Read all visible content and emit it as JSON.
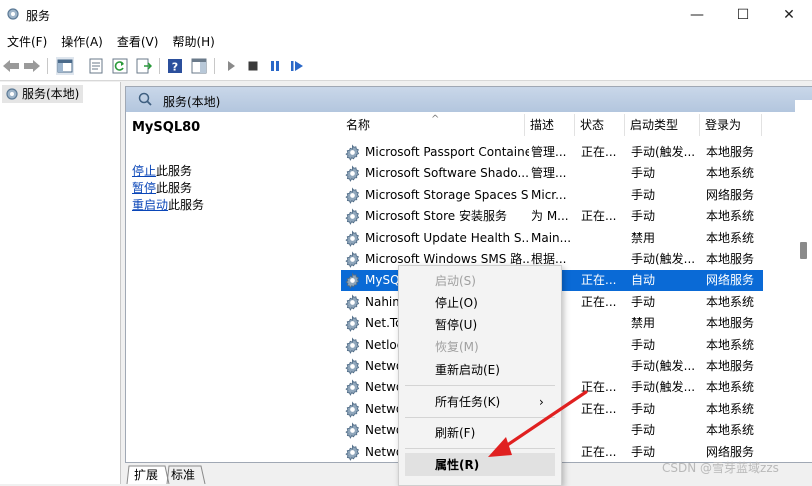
{
  "window": {
    "title": "服务",
    "minimize_label": "—",
    "maximize_label": "☐",
    "close_label": "✕"
  },
  "menu": [
    "文件(F)",
    "操作(A)",
    "查看(V)",
    "帮助(H)"
  ],
  "toolbar_icons": [
    "back-arrow-icon",
    "forward-arrow-icon",
    "show-hide-console-tree-icon",
    "properties-icon",
    "refresh-icon",
    "export-list-icon",
    "help-icon",
    "action-pane-icon",
    "start-service-icon",
    "stop-service-icon",
    "pause-service-icon",
    "restart-service-icon"
  ],
  "tree": {
    "root_label": "服务(本地)"
  },
  "main_header": "服务(本地)",
  "selected_service": {
    "name": "MySQL80",
    "actions": [
      {
        "link": "停止",
        "rest": "此服务"
      },
      {
        "link": "暂停",
        "rest": "此服务"
      },
      {
        "link": "重启动",
        "rest": "此服务"
      }
    ]
  },
  "columns": [
    "名称",
    "描述",
    "状态",
    "启动类型",
    "登录为"
  ],
  "rows": [
    {
      "name": "Microsoft Passport Container",
      "desc": "管理...",
      "status": "正在...",
      "startup": "手动(触发...",
      "logon": "本地服务"
    },
    {
      "name": "Microsoft Software Shado...",
      "desc": "管理...",
      "status": "",
      "startup": "手动",
      "logon": "本地系统"
    },
    {
      "name": "Microsoft Storage Spaces S...",
      "desc": "Micr...",
      "status": "",
      "startup": "手动",
      "logon": "网络服务"
    },
    {
      "name": "Microsoft Store 安装服务",
      "desc": "为 M...",
      "status": "正在...",
      "startup": "手动",
      "logon": "本地系统"
    },
    {
      "name": "Microsoft Update Health S...",
      "desc": "Main...",
      "status": "",
      "startup": "禁用",
      "logon": "本地系统"
    },
    {
      "name": "Microsoft Windows SMS 路...",
      "desc": "根据...",
      "status": "",
      "startup": "手动(触发...",
      "logon": "本地服务"
    },
    {
      "name": "MySQL80",
      "desc": "",
      "status": "正在...",
      "startup": "自动",
      "logon": "网络服务"
    },
    {
      "name": "Nahimic service",
      "desc": "",
      "status": "正在...",
      "startup": "手动",
      "logon": "本地系统"
    },
    {
      "name": "Net.Tcp Port Sharing Service",
      "desc": "",
      "status": "",
      "startup": "禁用",
      "logon": "本地服务"
    },
    {
      "name": "Netlogon",
      "desc": "",
      "status": "",
      "startup": "手动",
      "logon": "本地系统"
    },
    {
      "name": "Network Connected Devices...",
      "desc": "",
      "status": "",
      "startup": "手动(触发...",
      "logon": "本地服务"
    },
    {
      "name": "Network Connection Broker",
      "desc": "",
      "status": "正在...",
      "startup": "手动(触发...",
      "logon": "本地系统"
    },
    {
      "name": "Network Connections",
      "desc": "",
      "status": "正在...",
      "startup": "手动",
      "logon": "本地系统"
    },
    {
      "name": "Network Connectivity Assis...",
      "desc": "",
      "status": "",
      "startup": "手动",
      "logon": "本地系统"
    },
    {
      "name": "Network List Service",
      "desc": "",
      "status": "正在...",
      "startup": "手动",
      "logon": "网络服务"
    }
  ],
  "context_menu": [
    {
      "label": "启动(S)",
      "disabled": true
    },
    {
      "label": "停止(O)",
      "disabled": false
    },
    {
      "label": "暂停(U)",
      "disabled": false
    },
    {
      "label": "恢复(M)",
      "disabled": true
    },
    {
      "label": "重新启动(E)",
      "disabled": false
    },
    {
      "label": "所有任务(K)",
      "disabled": false,
      "submenu_arrow": "›"
    },
    {
      "label": "刷新(F)",
      "disabled": false
    },
    {
      "label": "属性(R)",
      "disabled": false,
      "highlighted": true
    }
  ],
  "bottom_tabs": [
    "扩展",
    "标准"
  ],
  "watermark": "CSDN @雪芽蓝域zzs",
  "colors": {
    "selection": "#0a6ad6",
    "header_bg": "#b3c6de",
    "arrow": "#e02020",
    "link": "#0a46b8"
  }
}
